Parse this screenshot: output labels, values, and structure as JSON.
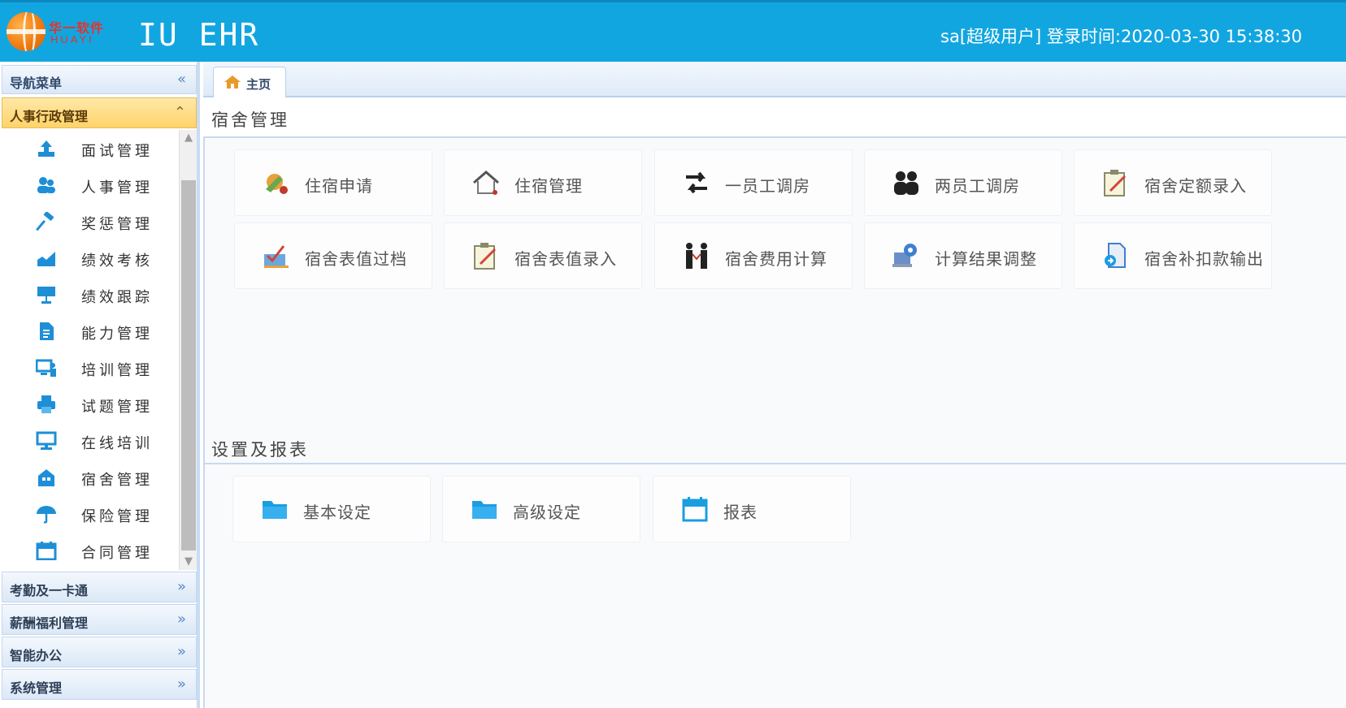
{
  "header": {
    "logo_cn": "华一软件",
    "logo_en": "HUAYI",
    "app_title": "IU EHR",
    "user_info": "sa[超级用户] 登录时间:2020-03-30 15:38:30"
  },
  "sidebar": {
    "nav_title": "导航菜单",
    "open_section": "人事行政管理",
    "items": [
      {
        "label": "面试管理",
        "icon": "upload-icon"
      },
      {
        "label": "人事管理",
        "icon": "users-icon"
      },
      {
        "label": "奖惩管理",
        "icon": "hammer-icon"
      },
      {
        "label": "绩效考核",
        "icon": "chart-icon"
      },
      {
        "label": "绩效跟踪",
        "icon": "presentation-icon"
      },
      {
        "label": "能力管理",
        "icon": "document-icon"
      },
      {
        "label": "培训管理",
        "icon": "monitor-user-icon"
      },
      {
        "label": "试题管理",
        "icon": "printer-icon"
      },
      {
        "label": "在线培训",
        "icon": "desktop-icon"
      },
      {
        "label": "宿舍管理",
        "icon": "building-icon"
      },
      {
        "label": "保险管理",
        "icon": "umbrella-icon"
      },
      {
        "label": "合同管理",
        "icon": "calendar-icon"
      }
    ],
    "sections": [
      "考勤及一卡通",
      "薪酬福利管理",
      "智能办公",
      "系统管理"
    ]
  },
  "tabs": [
    {
      "label": "主页",
      "icon": "home-icon"
    }
  ],
  "dorm_block": {
    "title": "宿舍管理",
    "tiles": [
      {
        "label": "住宿申请",
        "icon": "apply-icon"
      },
      {
        "label": "住宿管理",
        "icon": "house-icon"
      },
      {
        "label": "一员工调房",
        "icon": "swap-icon"
      },
      {
        "label": "两员工调房",
        "icon": "exchange-users-icon"
      },
      {
        "label": "宿舍定额录入",
        "icon": "edit-note-icon"
      },
      {
        "label": "宿舍表值过档",
        "icon": "checklist-icon"
      },
      {
        "label": "宿舍表值录入",
        "icon": "edit-note-icon"
      },
      {
        "label": "宿舍费用计算",
        "icon": "people-icon"
      },
      {
        "label": "计算结果调整",
        "icon": "computer-settings-icon"
      },
      {
        "label": "宿舍补扣款输出",
        "icon": "export-icon"
      }
    ]
  },
  "settings_block": {
    "title": "设置及报表",
    "tiles": [
      {
        "label": "基本设定",
        "icon": "folder-icon"
      },
      {
        "label": "高级设定",
        "icon": "folder-icon"
      },
      {
        "label": "报表",
        "icon": "calendar-icon"
      }
    ]
  },
  "colors": {
    "header_bg": "#12a6e0",
    "accent_blue": "#1a9ee0",
    "open_section_bg": "#ffd36a"
  }
}
